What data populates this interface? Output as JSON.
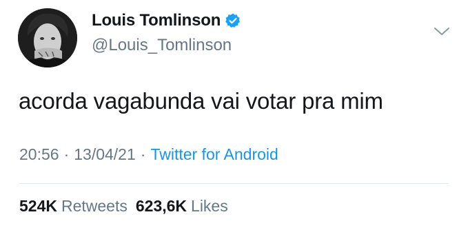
{
  "author": {
    "display_name": "Louis Tomlinson",
    "handle": "@Louis_Tomlinson",
    "verified": true,
    "avatar": "profile-photo"
  },
  "tweet": {
    "text": "acorda vagabunda vai votar pra mim",
    "time": "20:56",
    "separator": "·",
    "date": "13/04/21",
    "source": "Twitter for Android"
  },
  "stats": {
    "retweets_count": "524K",
    "retweets_label": "Retweets",
    "likes_count": "623,6K",
    "likes_label": "Likes"
  },
  "icons": {
    "verified": "verified-badge-icon",
    "menu": "chevron-down-icon"
  },
  "colors": {
    "text": "#14171a",
    "secondary": "#657786",
    "link": "#1b95e0",
    "divider": "#e1e8ed"
  }
}
